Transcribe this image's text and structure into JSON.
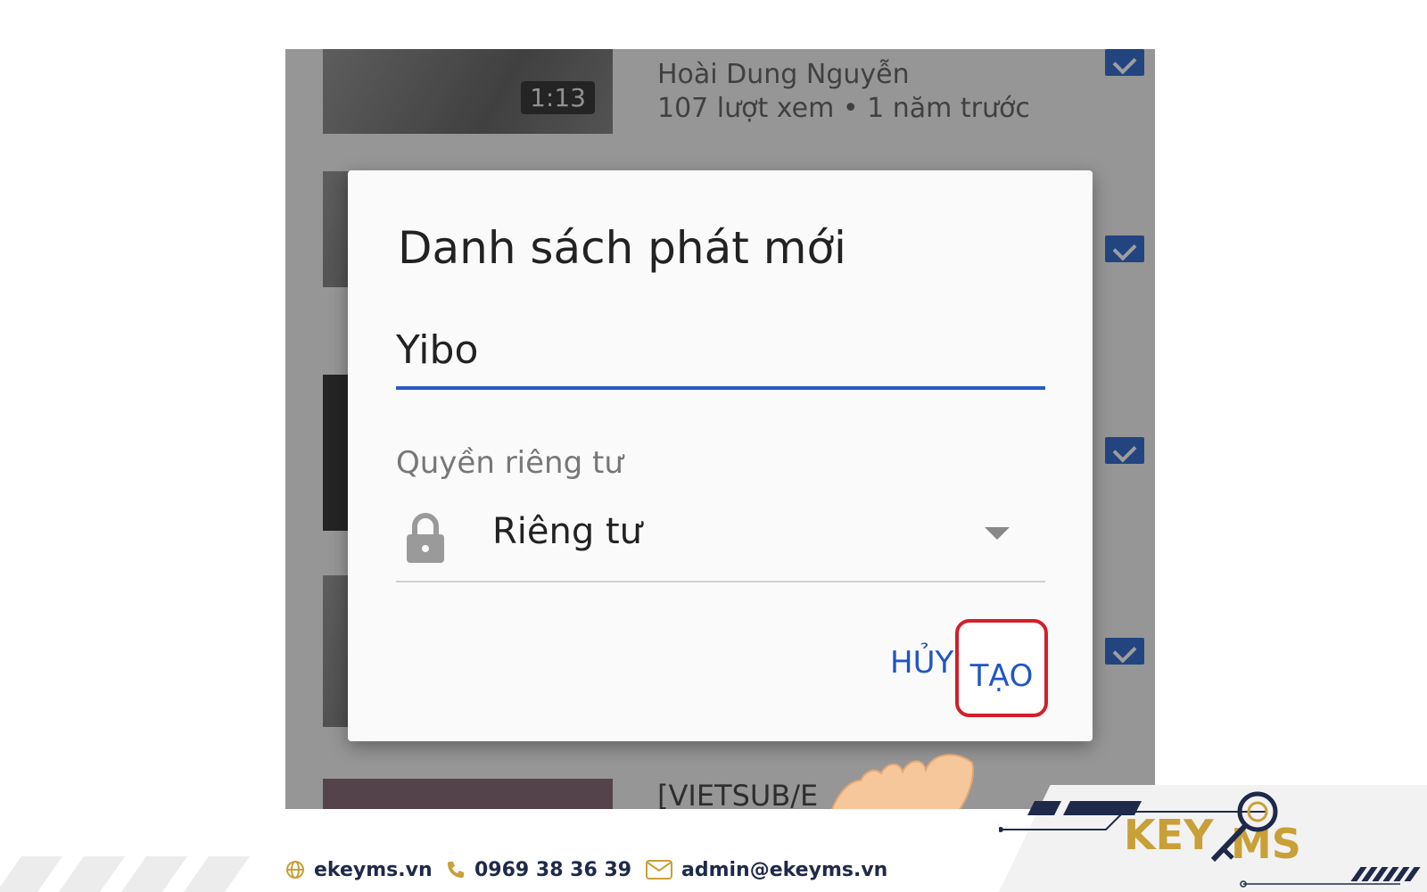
{
  "list": {
    "item1": {
      "duration": "1:13",
      "author": "Hoài Dung Nguyễn",
      "stats": "107 lượt xem • 1 năm trước"
    },
    "item5": {
      "title": "[VIETSUB/E"
    }
  },
  "dialog": {
    "title": "Danh sách phát mới",
    "playlist_name": "Yibo",
    "privacy_label": "Quyền riêng tư",
    "privacy_value": "Riêng tư",
    "cancel_label": "HỦY",
    "create_label": "TẠO"
  },
  "footer": {
    "website": "ekeyms.vn",
    "phone": "0969 38 36 39",
    "email": "admin@ekeyms.vn",
    "brand": "KEYMS"
  },
  "colors": {
    "accent_blue": "#1f56c4",
    "highlight_red": "#d31f2a",
    "brand_navy": "#1f2a4a",
    "brand_gold": "#c9a038"
  },
  "icons": [
    "lock-icon",
    "caret-down-icon",
    "hand-cursor-icon",
    "globe-icon",
    "phone-icon",
    "mail-icon",
    "key-icon"
  ]
}
